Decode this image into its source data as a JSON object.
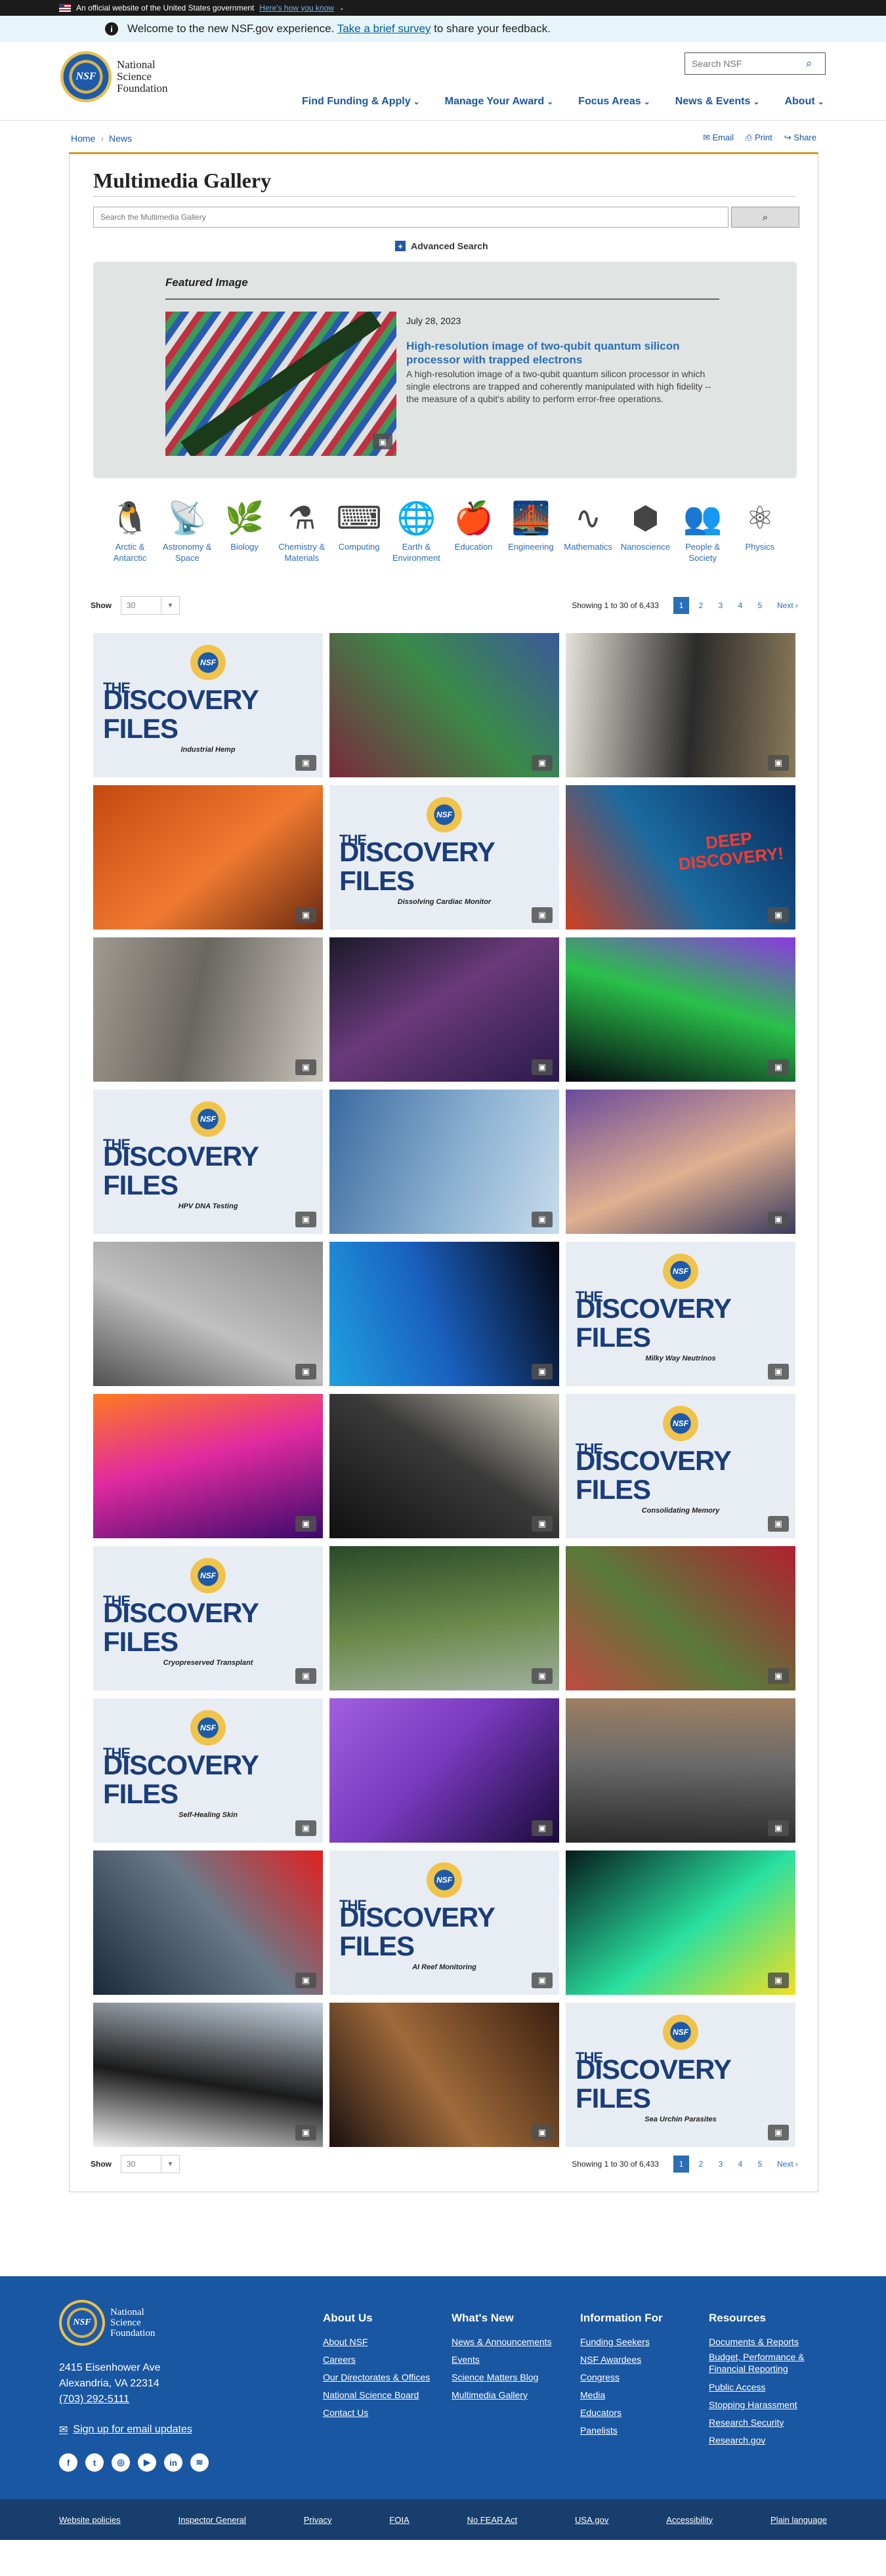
{
  "gov_banner": {
    "text": "An official website of the United States government",
    "link": "Here's how you know"
  },
  "welcome": {
    "icon": "info-icon",
    "text": "Welcome to the new NSF.gov experience.",
    "link": "Take a brief survey",
    "suffix": "to share your feedback."
  },
  "logo": {
    "line1": "National",
    "line2": "Science",
    "line3": "Foundation",
    "seal": "NSF"
  },
  "search": {
    "placeholder": "Search NSF"
  },
  "nav": [
    "Find Funding & Apply",
    "Manage Your Award",
    "Focus Areas",
    "News & Events",
    "About"
  ],
  "breadcrumb": {
    "home": "Home",
    "news": "News"
  },
  "tools": {
    "email": "Email",
    "print": "Print",
    "share": "Share"
  },
  "gallery": {
    "title": "Multimedia Gallery",
    "search_placeholder": "Search the Multimedia Gallery",
    "advanced": "Advanced Search",
    "featured": {
      "label": "Featured Image",
      "date": "July 28, 2023",
      "title": "High-resolution image of two-qubit quantum silicon processor with trapped electrons",
      "desc": "A high-resolution image of a two-qubit quantum silicon processor in which single electrons are trapped and coherently manipulated with high fidelity -- the measure of a qubit's ability to perform error-free operations."
    },
    "categories": [
      {
        "label": "Arctic & Antarctic",
        "icon": "penguin-icon",
        "glyph": "🐧"
      },
      {
        "label": "Astronomy & Space",
        "icon": "satellite-dish-icon",
        "glyph": "📡"
      },
      {
        "label": "Biology",
        "icon": "leaf-icon",
        "glyph": "🌿"
      },
      {
        "label": "Chemistry & Materials",
        "icon": "flask-icon",
        "glyph": "⚗"
      },
      {
        "label": "Computing",
        "icon": "circuit-icon",
        "glyph": "⌨"
      },
      {
        "label": "Earth & Environment",
        "icon": "globe-icon",
        "glyph": "🌐"
      },
      {
        "label": "Education",
        "icon": "apple-books-icon",
        "glyph": "🍎"
      },
      {
        "label": "Engineering",
        "icon": "bridge-icon",
        "glyph": "🌉"
      },
      {
        "label": "Mathematics",
        "icon": "graph-icon",
        "glyph": "∿"
      },
      {
        "label": "Nanoscience",
        "icon": "molecule-icon",
        "glyph": "⬢"
      },
      {
        "label": "People & Society",
        "icon": "people-icon",
        "glyph": "👥"
      },
      {
        "label": "Physics",
        "icon": "atom-icon",
        "glyph": "⚛"
      }
    ],
    "show_label": "Show",
    "show_value": "30",
    "showing": "Showing 1 to 30 of 6,433",
    "pages": [
      "1",
      "2",
      "3",
      "4",
      "5"
    ],
    "next": "Next ›",
    "tiles": [
      {
        "kind": "disc",
        "sub": "Industrial Hemp"
      },
      {
        "kind": "img",
        "colors": [
          "#7a2a3a",
          "#3b8a4a",
          "#3a5a9a"
        ]
      },
      {
        "kind": "img",
        "colors": [
          "#e6e2d9",
          "#2b2b2b",
          "#8a7a5a"
        ]
      },
      {
        "kind": "img",
        "colors": [
          "#c24a10",
          "#f07a30",
          "#6a2a10"
        ]
      },
      {
        "kind": "disc",
        "sub": "Dissolving Cardiac Monitor"
      },
      {
        "kind": "img",
        "colors": [
          "#0a2a5a",
          "#1a6aa0",
          "#d04020"
        ],
        "overlay": "DEEP DISCOVERY!"
      },
      {
        "kind": "img",
        "colors": [
          "#c8c4bc",
          "#6a6660",
          "#a09a90"
        ]
      },
      {
        "kind": "img",
        "colors": [
          "#2a1a4a",
          "#6a3a7a",
          "#1a1a2a"
        ]
      },
      {
        "kind": "img",
        "colors": [
          "#050510",
          "#2ac04a",
          "#8a3ae0"
        ]
      },
      {
        "kind": "disc",
        "sub": "HPV DNA Testing"
      },
      {
        "kind": "img",
        "colors": [
          "#3a6aa0",
          "#8ab0d0",
          "#c8dcec"
        ]
      },
      {
        "kind": "img",
        "colors": [
          "#6a4a9a",
          "#e0b090",
          "#3a3a60"
        ]
      },
      {
        "kind": "img",
        "colors": [
          "#8a8a8a",
          "#c0c0c0",
          "#505050"
        ]
      },
      {
        "kind": "img",
        "colors": [
          "#050510",
          "#1a60c0",
          "#20a0e0"
        ]
      },
      {
        "kind": "disc",
        "sub": "Milky Way Neutrinos"
      },
      {
        "kind": "img",
        "colors": [
          "#3a0a6a",
          "#e02aa0",
          "#ff7a20"
        ]
      },
      {
        "kind": "img",
        "colors": [
          "#101010",
          "#3a3a3a",
          "#c8c4b4"
        ]
      },
      {
        "kind": "disc",
        "sub": "Consolidating Memory"
      },
      {
        "kind": "disc",
        "sub": "Cryopreserved Transplant"
      },
      {
        "kind": "img",
        "colors": [
          "#2a4a2a",
          "#6a8a4a",
          "#a0b0a0"
        ]
      },
      {
        "kind": "img",
        "colors": [
          "#b02030",
          "#5a7a3a",
          "#c04a40"
        ]
      },
      {
        "kind": "disc",
        "sub": "Self-Healing Skin"
      },
      {
        "kind": "img",
        "colors": [
          "#1a0a3a",
          "#7a3ac0",
          "#a060e0"
        ]
      },
      {
        "kind": "img",
        "colors": [
          "#2a2a2a",
          "#6a6a6a",
          "#a08060"
        ]
      },
      {
        "kind": "img",
        "colors": [
          "#1a2a3a",
          "#6a7a8a",
          "#e02020"
        ]
      },
      {
        "kind": "disc",
        "sub": "AI Reef Monitoring"
      },
      {
        "kind": "img",
        "colors": [
          "#051a1a",
          "#2ae0a0",
          "#f0e020"
        ]
      },
      {
        "kind": "img",
        "colors": [
          "#c8d4e0",
          "#1a1a1a",
          "#f0f0f0"
        ]
      },
      {
        "kind": "img",
        "colors": [
          "#3a2010",
          "#a06a3a",
          "#1a1010"
        ]
      },
      {
        "kind": "disc",
        "sub": "Sea Urchin Parasites"
      }
    ]
  },
  "disc_title": {
    "the": "THE",
    "main": "DISCOVERY FILES",
    "seal": "NSF"
  },
  "footer": {
    "logo": {
      "line1": "National",
      "line2": "Science",
      "line3": "Foundation",
      "seal": "NSF"
    },
    "address1": "2415 Eisenhower Ave",
    "address2": "Alexandria, VA 22314",
    "phone": "(703) 292-5111",
    "email_signup": "Sign up for email updates",
    "social": [
      {
        "name": "facebook-icon",
        "glyph": "f"
      },
      {
        "name": "twitter-icon",
        "glyph": "t"
      },
      {
        "name": "instagram-icon",
        "glyph": "◎"
      },
      {
        "name": "youtube-icon",
        "glyph": "▶"
      },
      {
        "name": "linkedin-icon",
        "glyph": "in"
      },
      {
        "name": "rss-icon",
        "glyph": "≋"
      }
    ],
    "columns": [
      {
        "title": "About Us",
        "links": [
          "About NSF",
          "Careers",
          "Our Directorates & Offices",
          "National Science Board",
          "Contact Us"
        ]
      },
      {
        "title": "What's New",
        "links": [
          "News & Announcements",
          "Events",
          "Science Matters Blog",
          "Multimedia Gallery"
        ]
      },
      {
        "title": "Information For",
        "links": [
          "Funding Seekers",
          "NSF Awardees",
          "Congress",
          "Media",
          "Educators",
          "Panelists"
        ]
      },
      {
        "title": "Resources",
        "links": [
          "Documents & Reports",
          "Budget, Performance & Financial Reporting",
          "Public Access",
          "Stopping Harassment",
          "Research Security",
          "Research.gov"
        ]
      }
    ],
    "bottom": [
      "Website policies",
      "Inspector General",
      "Privacy",
      "FOIA",
      "No FEAR Act",
      "USA.gov",
      "Accessibility",
      "Plain language"
    ]
  }
}
